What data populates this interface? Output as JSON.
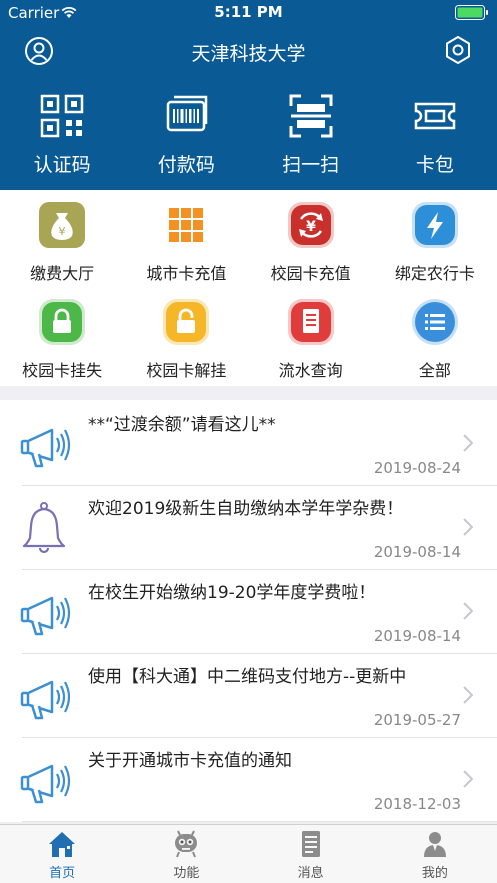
{
  "status_bar": {
    "carrier": "Carrier",
    "time": "5:11 PM"
  },
  "header": {
    "title": "天津科技大学"
  },
  "quick_actions": [
    {
      "label": "认证码",
      "icon": "qr-code-icon"
    },
    {
      "label": "付款码",
      "icon": "barcode-icon"
    },
    {
      "label": "扫一扫",
      "icon": "scan-icon"
    },
    {
      "label": "卡包",
      "icon": "ticket-icon"
    }
  ],
  "functions": [
    {
      "label": "缴费大厅",
      "icon": "money-bag-icon",
      "color": "#a8a655"
    },
    {
      "label": "城市卡充值",
      "icon": "grid-icon",
      "color": "#f39222"
    },
    {
      "label": "校园卡充值",
      "icon": "yuan-refresh-icon",
      "color": "#c9302c"
    },
    {
      "label": "绑定农行卡",
      "icon": "lightning-icon",
      "color": "#2d8fd8"
    },
    {
      "label": "校园卡挂失",
      "icon": "lock-icon",
      "color": "#4cb848"
    },
    {
      "label": "校园卡解挂",
      "icon": "unlock-icon",
      "color": "#f5b727"
    },
    {
      "label": "流水查询",
      "icon": "document-icon",
      "color": "#e03c3c"
    },
    {
      "label": "全部",
      "icon": "list-icon",
      "color": "#3a8fdc"
    }
  ],
  "news": [
    {
      "title": "**“过渡余额”请看这儿**",
      "date": "2019-08-24",
      "icon": "megaphone-icon"
    },
    {
      "title": "欢迎2019级新生自助缴纳本学年学杂费！",
      "date": "2019-08-14",
      "icon": "bell-icon"
    },
    {
      "title": "在校生开始缴纳19-20学年度学费啦！",
      "date": "2019-08-14",
      "icon": "megaphone-icon"
    },
    {
      "title": "使用【科大通】中二维码支付地方--更新中",
      "date": "2019-05-27",
      "icon": "megaphone-icon"
    },
    {
      "title": "关于开通城市卡充值的通知",
      "date": "2018-12-03",
      "icon": "megaphone-icon"
    }
  ],
  "tabs": [
    {
      "label": "首页",
      "icon": "home-icon",
      "active": true
    },
    {
      "label": "功能",
      "icon": "robot-icon",
      "active": false
    },
    {
      "label": "消息",
      "icon": "message-icon",
      "active": false
    },
    {
      "label": "我的",
      "icon": "profile-icon",
      "active": false
    }
  ],
  "colors": {
    "brand": "#0a5a96",
    "tab_active": "#1f6fb2",
    "battery": "#4cd964"
  }
}
